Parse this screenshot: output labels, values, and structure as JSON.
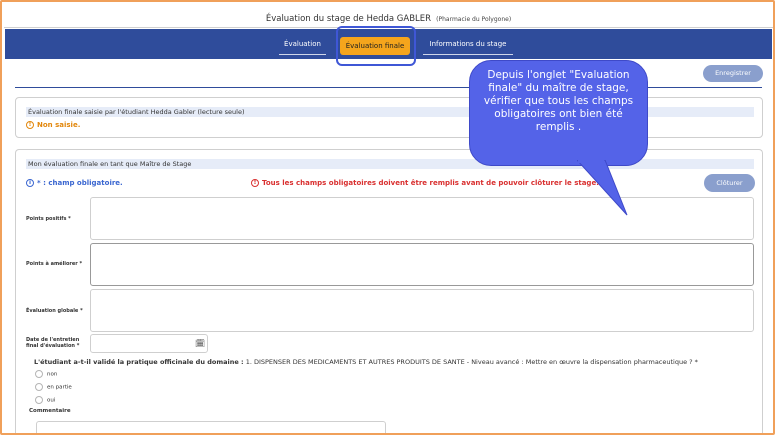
{
  "header": {
    "title": "Évaluation du stage de Hedda GABLER",
    "subtitle": "(Pharmacie du Polygone)"
  },
  "tabs": [
    {
      "label": "Évaluation",
      "active": false
    },
    {
      "label": "Évaluation finale",
      "active": true
    },
    {
      "label": "Informations du stage",
      "active": false
    }
  ],
  "toolbar": {
    "save_label": "Enregistrer"
  },
  "student_section": {
    "heading": "Évaluation finale saisie par l'étudiant Hedda Gabler (lecture seule)",
    "status": "Non saisie."
  },
  "mentor_section": {
    "heading": "Mon évaluation finale en tant que Maître de Stage",
    "required_note": "* : champ obligatoire.",
    "warning": "Tous les champs obligatoires doivent être remplis avant de pouvoir clôturer le stage.",
    "close_label": "Clôturer",
    "fields": {
      "positive": "Points positifs *",
      "improve": "Points à améliorer *",
      "global": "Évaluation globale *",
      "date_line1": "Date de l'entretien",
      "date_line2": "final d'évaluation *"
    },
    "question_bold": "L'étudiant a-t-il validé la pratique officinale du domaine :",
    "question_text": " 1. DISPENSER DES MEDICAMENTS ET AUTRES PRODUITS DE SANTE - Niveau avancé : Mettre en œuvre la dispensation pharmaceutique ? *",
    "options": [
      "non",
      "en partie",
      "oui"
    ],
    "comment_label": "Commentaire"
  },
  "tooltip": {
    "text": "Depuis l'onglet \"Evaluation finale\" du maître de stage, vérifier que tous les champs obligatoires ont bien été remplis ."
  },
  "colors": {
    "navbar": "#2f4c9b",
    "active_tab": "#f5a51c",
    "button": "#8a9fcd",
    "tooltip": "#5463e8",
    "warning_red": "#d93030",
    "status_orange": "#e2870c"
  }
}
